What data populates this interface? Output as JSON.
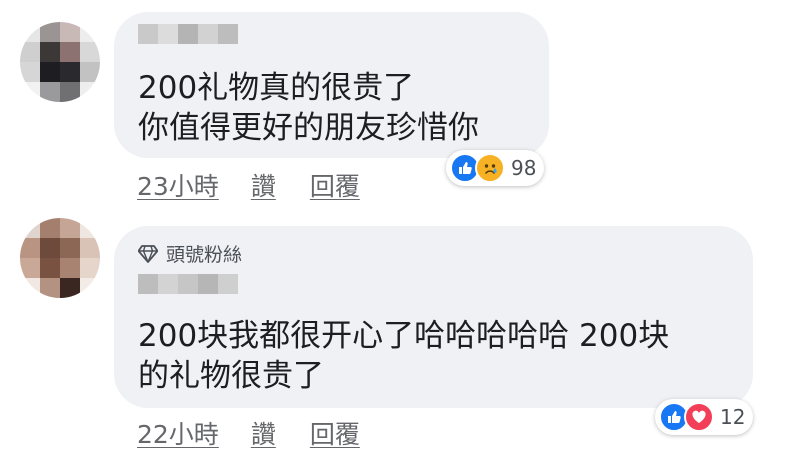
{
  "comments": [
    {
      "text_lines": [
        "200礼物真的很贵了",
        "你值得更好的朋友珍惜你"
      ],
      "timestamp": "23小時",
      "like_label": "讚",
      "reply_label": "回覆",
      "reactions": {
        "icons": [
          "like-icon",
          "sad-icon"
        ],
        "count": "98"
      },
      "badge": null
    },
    {
      "badge": {
        "icon": "diamond-icon",
        "label": "頭號粉絲"
      },
      "text_lines": [
        "200块我都很开心了哈哈哈哈哈 200块",
        "的礼物很贵了"
      ],
      "timestamp": "22小時",
      "like_label": "讚",
      "reply_label": "回覆",
      "reactions": {
        "icons": [
          "like-icon",
          "love-icon"
        ],
        "count": "12"
      }
    }
  ],
  "colors": {
    "bubble": "#eff1f5",
    "text": "#1c1e21",
    "meta": "#65676b",
    "like_blue": "#1877f2",
    "love_red": "#f33e58",
    "sad_yellow": "#f7b125"
  }
}
